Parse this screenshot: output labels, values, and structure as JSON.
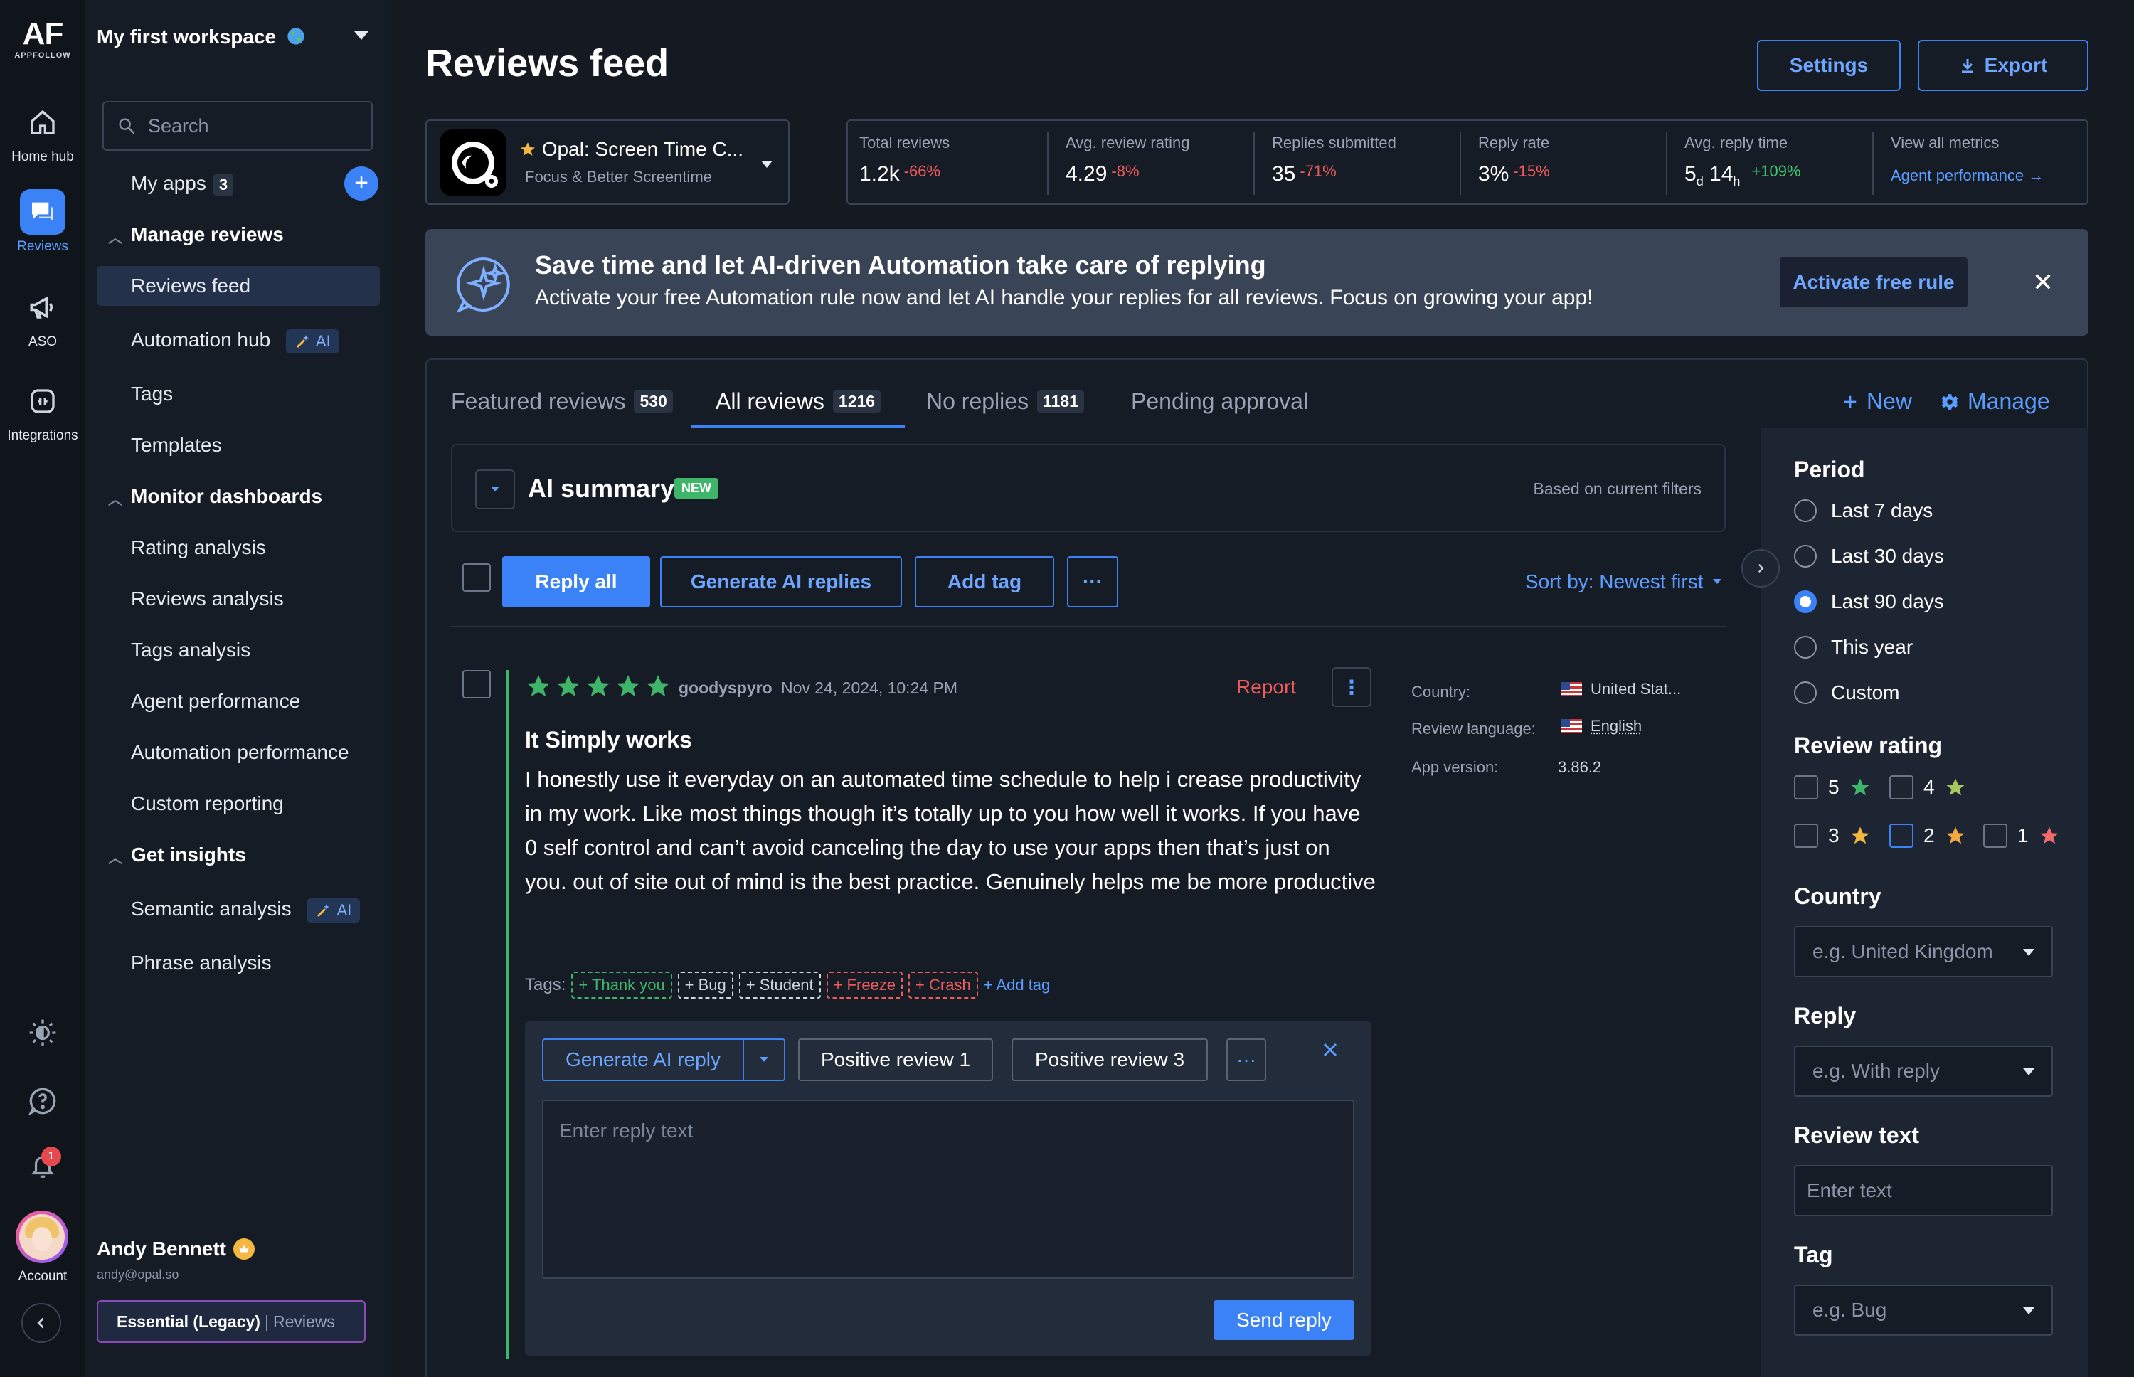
{
  "rail": {
    "logo": "AF",
    "logo_sub": "APPFOLLOW",
    "items": [
      {
        "label": "Home hub",
        "icon": "home-icon"
      },
      {
        "label": "Reviews",
        "icon": "reviews-icon"
      },
      {
        "label": "ASO",
        "icon": "megaphone-icon"
      },
      {
        "label": "Integrations",
        "icon": "integrations-icon"
      }
    ],
    "notification_count": "1",
    "account_label": "Account"
  },
  "nav": {
    "workspace": "My first workspace",
    "search_placeholder": "Search",
    "my_apps": "My apps",
    "my_apps_count": "3",
    "ai_label": "AI",
    "sections": {
      "manage": "Manage reviews",
      "monitor": "Monitor dashboards",
      "insights": "Get insights"
    },
    "items": {
      "reviews_feed": "Reviews feed",
      "automation_hub": "Automation hub",
      "tags": "Tags",
      "templates": "Templates",
      "rating_analysis": "Rating analysis",
      "reviews_analysis": "Reviews analysis",
      "tags_analysis": "Tags analysis",
      "agent_performance": "Agent performance",
      "automation_performance": "Automation performance",
      "custom_reporting": "Custom reporting",
      "semantic_analysis": "Semantic analysis",
      "phrase_analysis": "Phrase analysis"
    },
    "user": {
      "name": "Andy Bennett",
      "email": "andy@opal.so",
      "plan": "Essential (Legacy)",
      "plan_separator": "|",
      "plan_product": "Reviews"
    }
  },
  "header": {
    "title": "Reviews feed",
    "settings": "Settings",
    "export": "Export"
  },
  "app": {
    "name": "Opal: Screen Time C...",
    "subtitle": "Focus & Better Screentime"
  },
  "metrics": {
    "total_reviews": {
      "label": "Total reviews",
      "value": "1.2k",
      "change": "-66%"
    },
    "avg_rating": {
      "label": "Avg. review rating",
      "value": "4.29",
      "change": "-8%"
    },
    "replies": {
      "label": "Replies submitted",
      "value": "35",
      "change": "-71%"
    },
    "reply_rate": {
      "label": "Reply rate",
      "value": "3%",
      "change": "-15%"
    },
    "reply_time": {
      "label": "Avg. reply time",
      "days": "5",
      "days_unit": "d",
      "hours": "14",
      "hours_unit": "h",
      "change": "+109%"
    },
    "view_all": {
      "label": "View all metrics",
      "link": "Agent performance →"
    }
  },
  "banner": {
    "title": "Save time and let AI-driven Automation take care of replying",
    "text": "Activate your free Automation rule now and let AI handle your replies for all reviews. Focus on growing your app!",
    "button": "Activate free rule"
  },
  "tabs": {
    "featured": "Featured reviews",
    "featured_count": "530",
    "all": "All reviews",
    "all_count": "1216",
    "no_replies": "No replies",
    "no_replies_count": "1181",
    "pending": "Pending approval",
    "new": "New",
    "manage": "Manage"
  },
  "ai_summary": {
    "title": "AI summary",
    "badge": "NEW",
    "note": "Based on current filters"
  },
  "toolbar": {
    "reply_all": "Reply all",
    "generate_ai": "Generate AI replies",
    "add_tag": "Add tag",
    "more": "···",
    "sort": "Sort by: Newest first"
  },
  "review": {
    "rating": 5,
    "author": "goodyspyro",
    "date": "Nov 24, 2024, 10:24 PM",
    "report": "Report",
    "title": "It Simply works",
    "body": "I honestly use it everyday on an automated time schedule to help i crease productivity in my work. Like most things though it’s totally up to you how well it works. If you have 0 self control and can’t avoid canceling the day to use your apps then that’s just on you. out of site out of mind is the best practice. Genuinely helps me be more productive",
    "tags_label": "Tags:",
    "tags": [
      {
        "label": "+ Thank you",
        "color": "#3fb56a"
      },
      {
        "label": "+ Bug",
        "color": "#cfd5df"
      },
      {
        "label": "+ Student",
        "color": "#cfd5df"
      },
      {
        "label": "+ Freeze",
        "color": "#ef5a5a"
      },
      {
        "label": "+ Crash",
        "color": "#ef5a5a"
      }
    ],
    "add_tag": "+ Add tag",
    "meta": {
      "country_label": "Country:",
      "country": "United Stat...",
      "language_label": "Review language:",
      "language": "English",
      "version_label": "App version:",
      "version": "3.86.2"
    }
  },
  "reply": {
    "generate": "Generate AI reply",
    "template1": "Positive review 1",
    "template3": "Positive review 3",
    "more": "···",
    "placeholder": "Enter reply text",
    "send": "Send reply"
  },
  "filters": {
    "period_title": "Period",
    "period_options": [
      "Last 7 days",
      "Last 30 days",
      "Last 90 days",
      "This year",
      "Custom"
    ],
    "period_selected": "Last 90 days",
    "rating_title": "Review rating",
    "ratings": [
      "5",
      "4",
      "3",
      "2",
      "1"
    ],
    "country_title": "Country",
    "country_placeholder": "e.g. United Kingdom",
    "reply_title": "Reply",
    "reply_placeholder": "e.g. With reply",
    "text_title": "Review text",
    "text_placeholder": "Enter text",
    "tag_title": "Tag",
    "tag_placeholder": "e.g. Bug"
  },
  "colors": {
    "accent": "#3b82f6",
    "positive": "#41c46a",
    "negative": "#ef5a5a",
    "star_green": "#3fb56a",
    "star_gold": "#f4b840",
    "star_red": "#f06a6a"
  }
}
